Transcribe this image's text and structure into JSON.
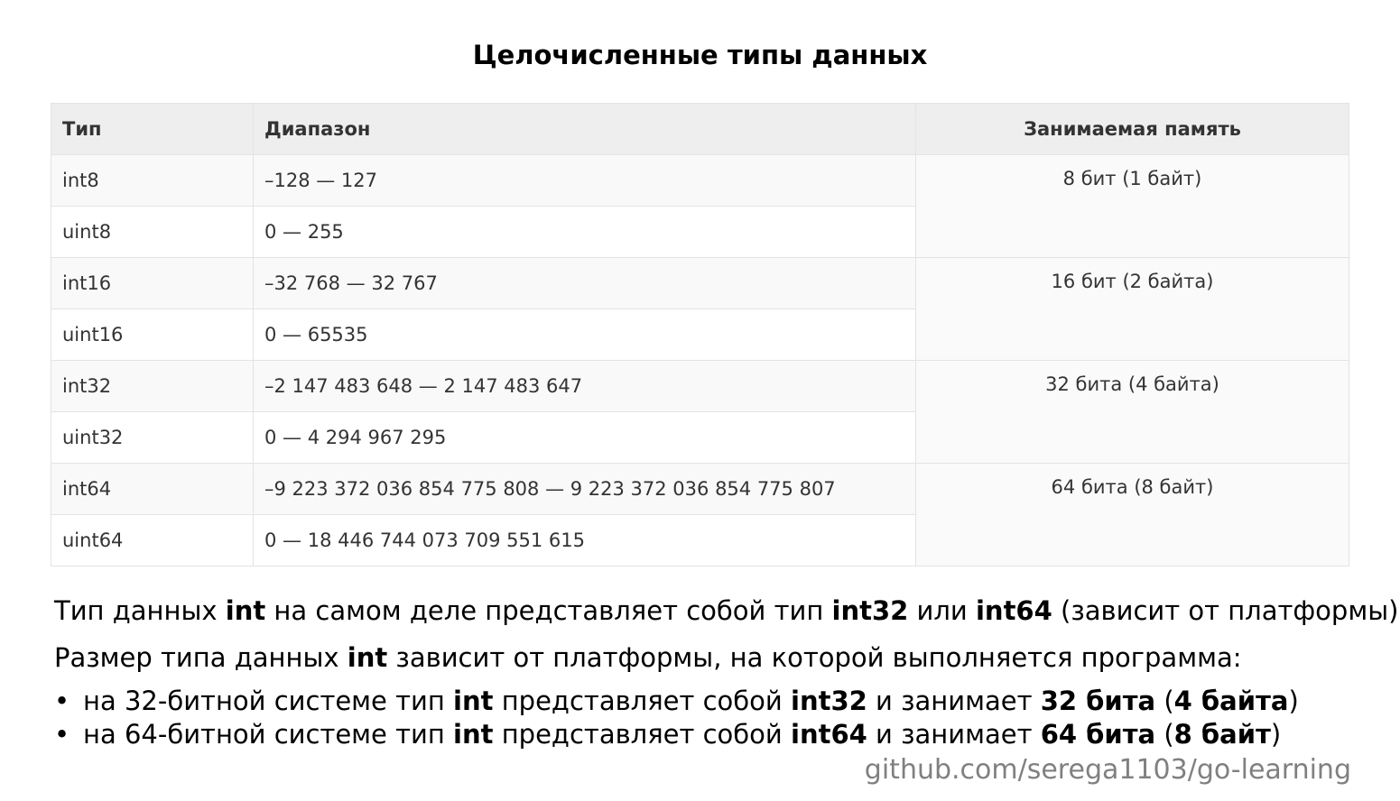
{
  "title": "Целочисленные типы данных",
  "table": {
    "headers": [
      "Тип",
      "Диапазон",
      "Занимаемая память"
    ],
    "rows": [
      {
        "type": "int8",
        "range": "–128 — 127"
      },
      {
        "type": "uint8",
        "range": "0 — 255"
      },
      {
        "type": "int16",
        "range": "–32 768 — 32 767"
      },
      {
        "type": "uint16",
        "range": "0 — 65535"
      },
      {
        "type": "int32",
        "range": "–2 147 483 648 — 2 147 483 647"
      },
      {
        "type": "uint32",
        "range": "0 — 4 294 967 295"
      },
      {
        "type": "int64",
        "range": "–9 223 372 036 854 775 808 — 9 223 372 036 854 775 807"
      },
      {
        "type": "uint64",
        "range": "0 — 18 446 744 073 709 551 615"
      }
    ],
    "memory": [
      "8 бит (1 байт)",
      "16 бит (2 байта)",
      "32 бита (4 байта)",
      "64 бита (8 байт)"
    ]
  },
  "paragraph1": [
    "Тип данных ",
    "int",
    " на самом деле представляет собой тип ",
    "int32",
    " или ",
    "int64",
    " (зависит от платформы)."
  ],
  "paragraph2": [
    "Размер типа данных ",
    "int",
    " зависит от платформы, на которой выполняется программа:"
  ],
  "bullets": [
    {
      "bullet": "•",
      "parts": [
        "на 32-битной системе тип ",
        "int",
        " представляет собой ",
        "int32",
        " и занимает ",
        "32 бита",
        " (",
        "4 байта",
        ")"
      ]
    },
    {
      "bullet": "•",
      "parts": [
        "на 64-битной системе тип ",
        "int",
        " представляет собой ",
        "int64",
        " и занимает ",
        "64 бита",
        " (",
        "8 байт",
        ")"
      ]
    }
  ],
  "footer": "github.com/serega1103/go-learning"
}
